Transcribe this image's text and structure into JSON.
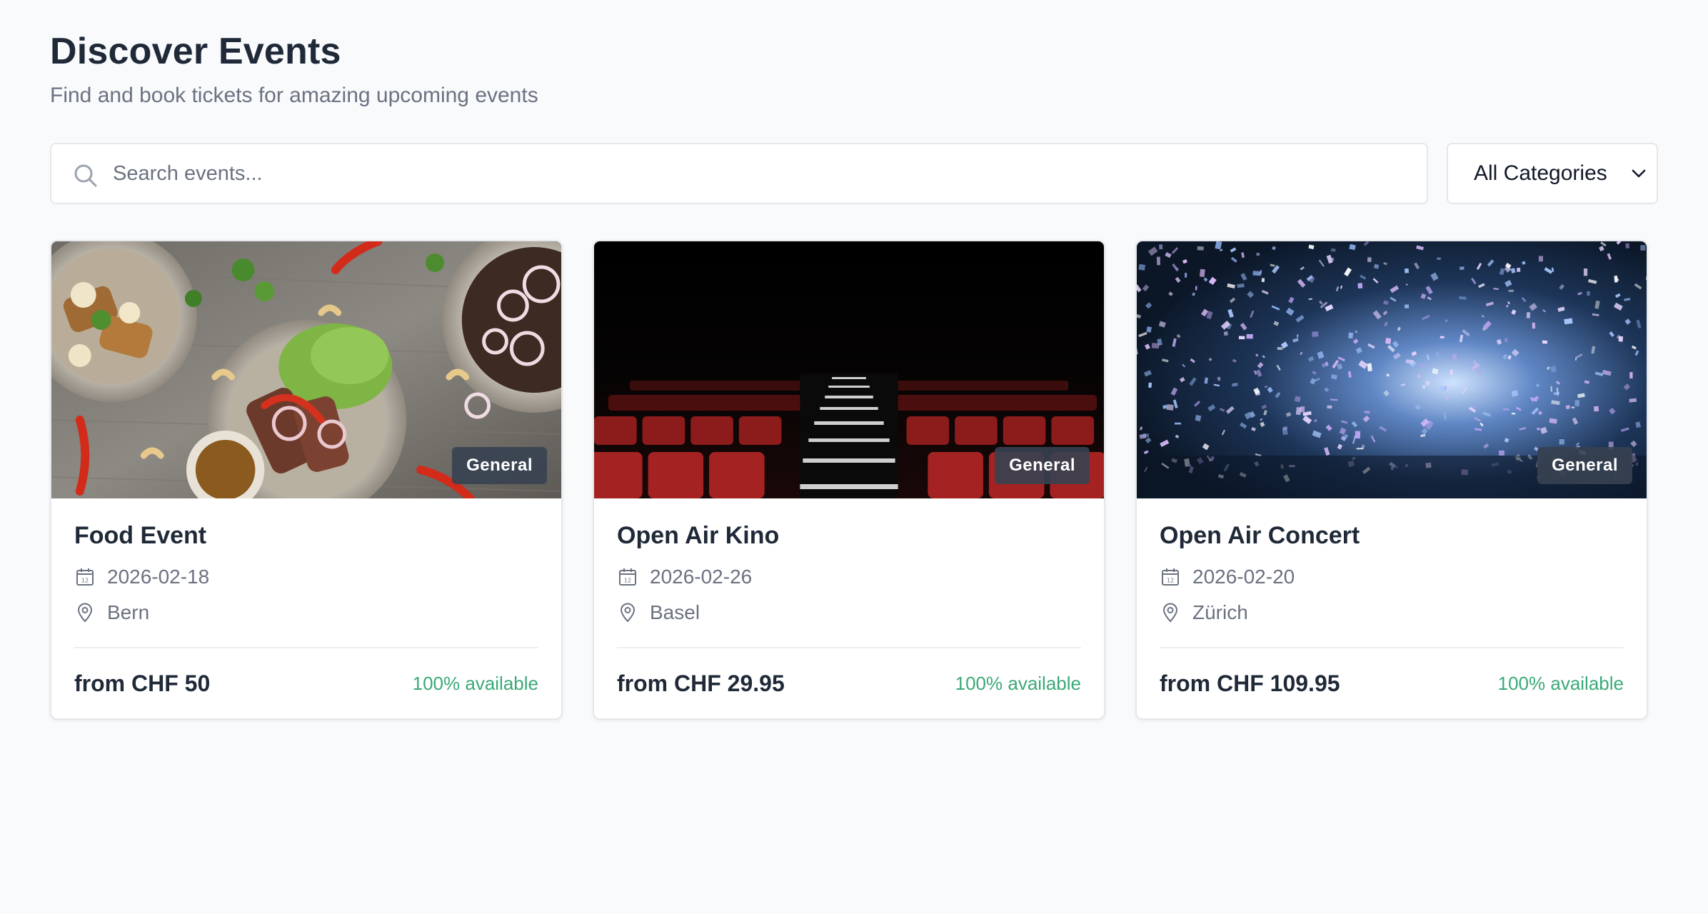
{
  "header": {
    "title": "Discover Events",
    "subtitle": "Find and book tickets for amazing upcoming events"
  },
  "search": {
    "placeholder": "Search events...",
    "value": "",
    "icon": "search-icon"
  },
  "category_filter": {
    "selected": "All Categories",
    "icon": "chevron-down-icon"
  },
  "colors": {
    "background": "#f8fafc",
    "title": "#1f2937",
    "muted": "#6b7280",
    "badge": "#374151",
    "available": "#3aa977"
  },
  "events": [
    {
      "title": "Food Event",
      "badge": "General",
      "date": "2026-02-18",
      "location": "Bern",
      "price": "from CHF 50",
      "availability": "100% available",
      "image": "food-photo"
    },
    {
      "title": "Open Air Kino",
      "badge": "General",
      "date": "2026-02-26",
      "location": "Basel",
      "price": "from CHF 29.95",
      "availability": "100% available",
      "image": "cinema-seats-photo"
    },
    {
      "title": "Open Air Concert",
      "badge": "General",
      "date": "2026-02-20",
      "location": "Zürich",
      "price": "from CHF 109.95",
      "availability": "100% available",
      "image": "confetti-concert-photo"
    }
  ]
}
